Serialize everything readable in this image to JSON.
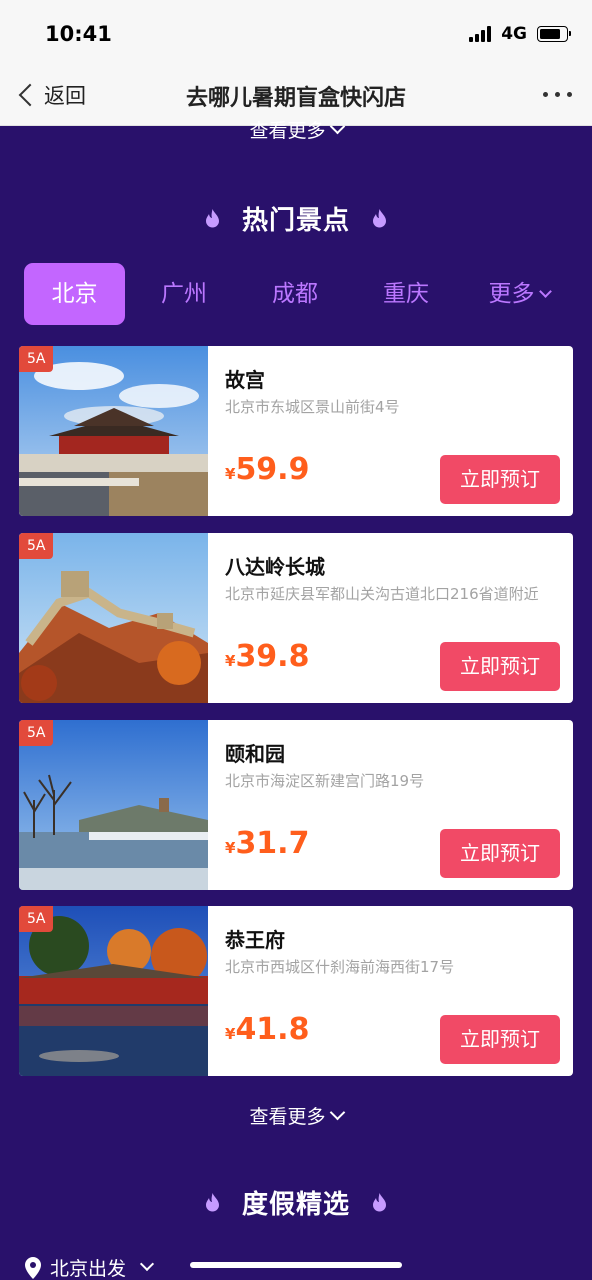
{
  "status_bar": {
    "time": "10:41",
    "network": "4G"
  },
  "nav": {
    "back_label": "返回",
    "title": "去哪儿暑期盲盒快闪店"
  },
  "view_more_top": "查看更多",
  "section_hot": {
    "title": "热门景点"
  },
  "city_tabs": [
    "北京",
    "广州",
    "成都",
    "重庆",
    "更多"
  ],
  "active_tab": "北京",
  "attractions": [
    {
      "badge": "5A",
      "name": "故宫",
      "address": "北京市东城区景山前街4号",
      "currency": "¥",
      "price": "59.9",
      "button": "立即预订",
      "image": "forbidden-city"
    },
    {
      "badge": "5A",
      "name": "八达岭长城",
      "address": "北京市延庆县军都山关沟古道北口216省道附近",
      "currency": "¥",
      "price": "39.8",
      "button": "立即预订",
      "image": "great-wall"
    },
    {
      "badge": "5A",
      "name": "颐和园",
      "address": "北京市海淀区新建宫门路19号",
      "currency": "¥",
      "price": "31.7",
      "button": "立即预订",
      "image": "summer-palace"
    },
    {
      "badge": "5A",
      "name": "恭王府",
      "address": "北京市西城区什刹海前海西街17号",
      "currency": "¥",
      "price": "41.8",
      "button": "立即预订",
      "image": "prince-gong-mansion"
    }
  ],
  "view_more_bottom": "查看更多",
  "section_vacation": {
    "title": "度假精选"
  },
  "location": {
    "label": "北京出发"
  },
  "colors": {
    "page_bg": "#29116b",
    "tab_active": "#c366ff",
    "tab_text": "#bb77ff",
    "price": "#ff5e1c",
    "button": "#f14a66",
    "badge": "#e24a3b"
  }
}
